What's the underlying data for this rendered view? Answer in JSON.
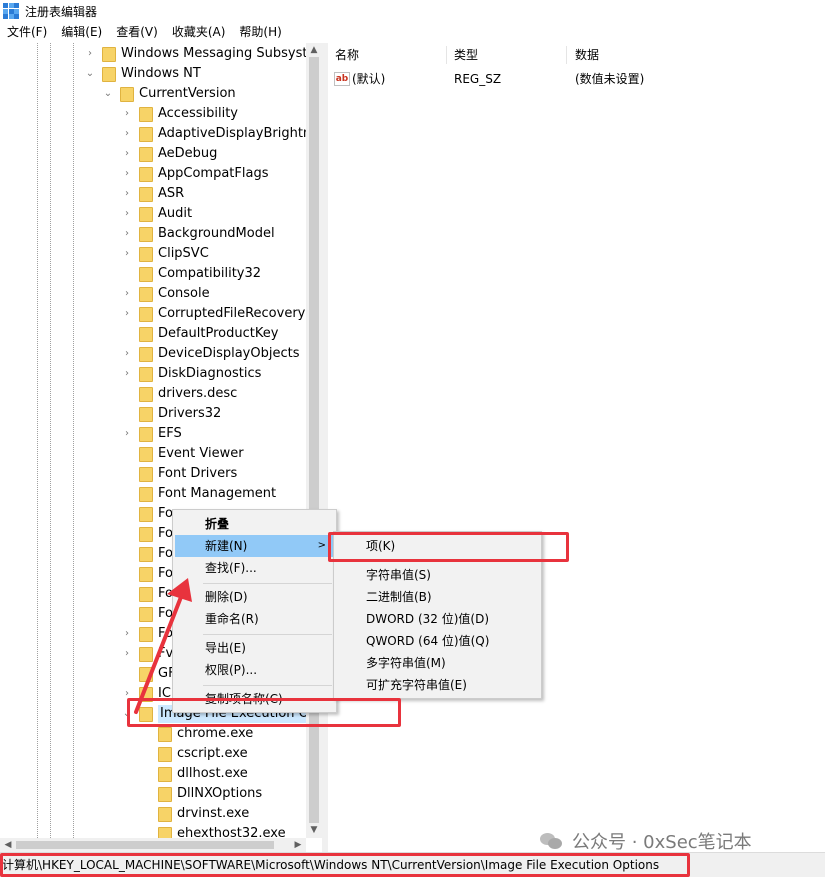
{
  "window": {
    "title": "注册表编辑器"
  },
  "menubar": [
    "文件(F)",
    "编辑(E)",
    "查看(V)",
    "收藏夹(A)",
    "帮助(H)"
  ],
  "tree": {
    "items": [
      {
        "label": "Windows Messaging Subsysten",
        "level": 0,
        "expander": "collapsed"
      },
      {
        "label": "Windows NT",
        "level": 0,
        "expander": "expanded"
      },
      {
        "label": "CurrentVersion",
        "level": 1,
        "expander": "expanded"
      },
      {
        "label": "Accessibility",
        "level": 2,
        "expander": "collapsed"
      },
      {
        "label": "AdaptiveDisplayBrightnes",
        "level": 2,
        "expander": "collapsed"
      },
      {
        "label": "AeDebug",
        "level": 2,
        "expander": "collapsed"
      },
      {
        "label": "AppCompatFlags",
        "level": 2,
        "expander": "collapsed"
      },
      {
        "label": "ASR",
        "level": 2,
        "expander": "collapsed"
      },
      {
        "label": "Audit",
        "level": 2,
        "expander": "collapsed"
      },
      {
        "label": "BackgroundModel",
        "level": 2,
        "expander": "collapsed"
      },
      {
        "label": "ClipSVC",
        "level": 2,
        "expander": "collapsed"
      },
      {
        "label": "Compatibility32",
        "level": 2,
        "expander": "none"
      },
      {
        "label": "Console",
        "level": 2,
        "expander": "collapsed"
      },
      {
        "label": "CorruptedFileRecovery",
        "level": 2,
        "expander": "collapsed"
      },
      {
        "label": "DefaultProductKey",
        "level": 2,
        "expander": "none"
      },
      {
        "label": "DeviceDisplayObjects",
        "level": 2,
        "expander": "collapsed"
      },
      {
        "label": "DiskDiagnostics",
        "level": 2,
        "expander": "collapsed"
      },
      {
        "label": "drivers.desc",
        "level": 2,
        "expander": "none"
      },
      {
        "label": "Drivers32",
        "level": 2,
        "expander": "none"
      },
      {
        "label": "EFS",
        "level": 2,
        "expander": "collapsed"
      },
      {
        "label": "Event Viewer",
        "level": 2,
        "expander": "none"
      },
      {
        "label": "Font Drivers",
        "level": 2,
        "expander": "none"
      },
      {
        "label": "Font Management",
        "level": 2,
        "expander": "none"
      },
      {
        "label": "Fo",
        "level": 2,
        "expander": "none"
      },
      {
        "label": "Fo",
        "level": 2,
        "expander": "none"
      },
      {
        "label": "Fo",
        "level": 2,
        "expander": "none"
      },
      {
        "label": "Fo",
        "level": 2,
        "expander": "none"
      },
      {
        "label": "Fo",
        "level": 2,
        "expander": "none"
      },
      {
        "label": "Fo",
        "level": 2,
        "expander": "none"
      },
      {
        "label": "Fo",
        "level": 2,
        "expander": "collapsed"
      },
      {
        "label": "Fv",
        "level": 2,
        "expander": "collapsed"
      },
      {
        "label": "GF",
        "level": 2,
        "expander": "none"
      },
      {
        "label": "IC",
        "level": 2,
        "expander": "collapsed"
      },
      {
        "label": "Image File Execution Opt",
        "level": 2,
        "expander": "expanded",
        "selected": true
      },
      {
        "label": "chrome.exe",
        "level": 3,
        "expander": "none"
      },
      {
        "label": "cscript.exe",
        "level": 3,
        "expander": "none"
      },
      {
        "label": "dllhost.exe",
        "level": 3,
        "expander": "none"
      },
      {
        "label": "DllNXOptions",
        "level": 3,
        "expander": "none"
      },
      {
        "label": "drvinst.exe",
        "level": 3,
        "expander": "none"
      },
      {
        "label": "ehexthost32.exe",
        "level": 3,
        "expander": "none"
      }
    ]
  },
  "values": {
    "headers": {
      "name": "名称",
      "type": "类型",
      "data": "数据"
    },
    "rows": [
      {
        "icon": "ab",
        "name": "(默认)",
        "type": "REG_SZ",
        "data": "(数值未设置)"
      }
    ]
  },
  "context_menu": {
    "items": [
      {
        "label": "折叠",
        "bold": true
      },
      {
        "label": "新建(N)",
        "submenu": true,
        "highlighted": true
      },
      {
        "label": "查找(F)..."
      },
      {
        "label": "删除(D)"
      },
      {
        "label": "重命名(R)"
      },
      {
        "label": "导出(E)"
      },
      {
        "label": "权限(P)..."
      },
      {
        "label": "复制项名称(C)"
      }
    ]
  },
  "submenu": {
    "items": [
      "项(K)",
      "字符串值(S)",
      "二进制值(B)",
      "DWORD (32 位)值(D)",
      "QWORD (64 位)值(Q)",
      "多字符串值(M)",
      "可扩充字符串值(E)"
    ]
  },
  "status_bar": {
    "path": "计算机\\HKEY_LOCAL_MACHINE\\SOFTWARE\\Microsoft\\Windows NT\\CurrentVersion\\Image File Execution Options"
  },
  "watermark": {
    "text": "公众号 · 0xSec笔记本"
  },
  "colors": {
    "highlight": "#91c9f7",
    "annotation": "#e8333d",
    "folder": "#f7d367",
    "selection": "#cce8ff"
  }
}
